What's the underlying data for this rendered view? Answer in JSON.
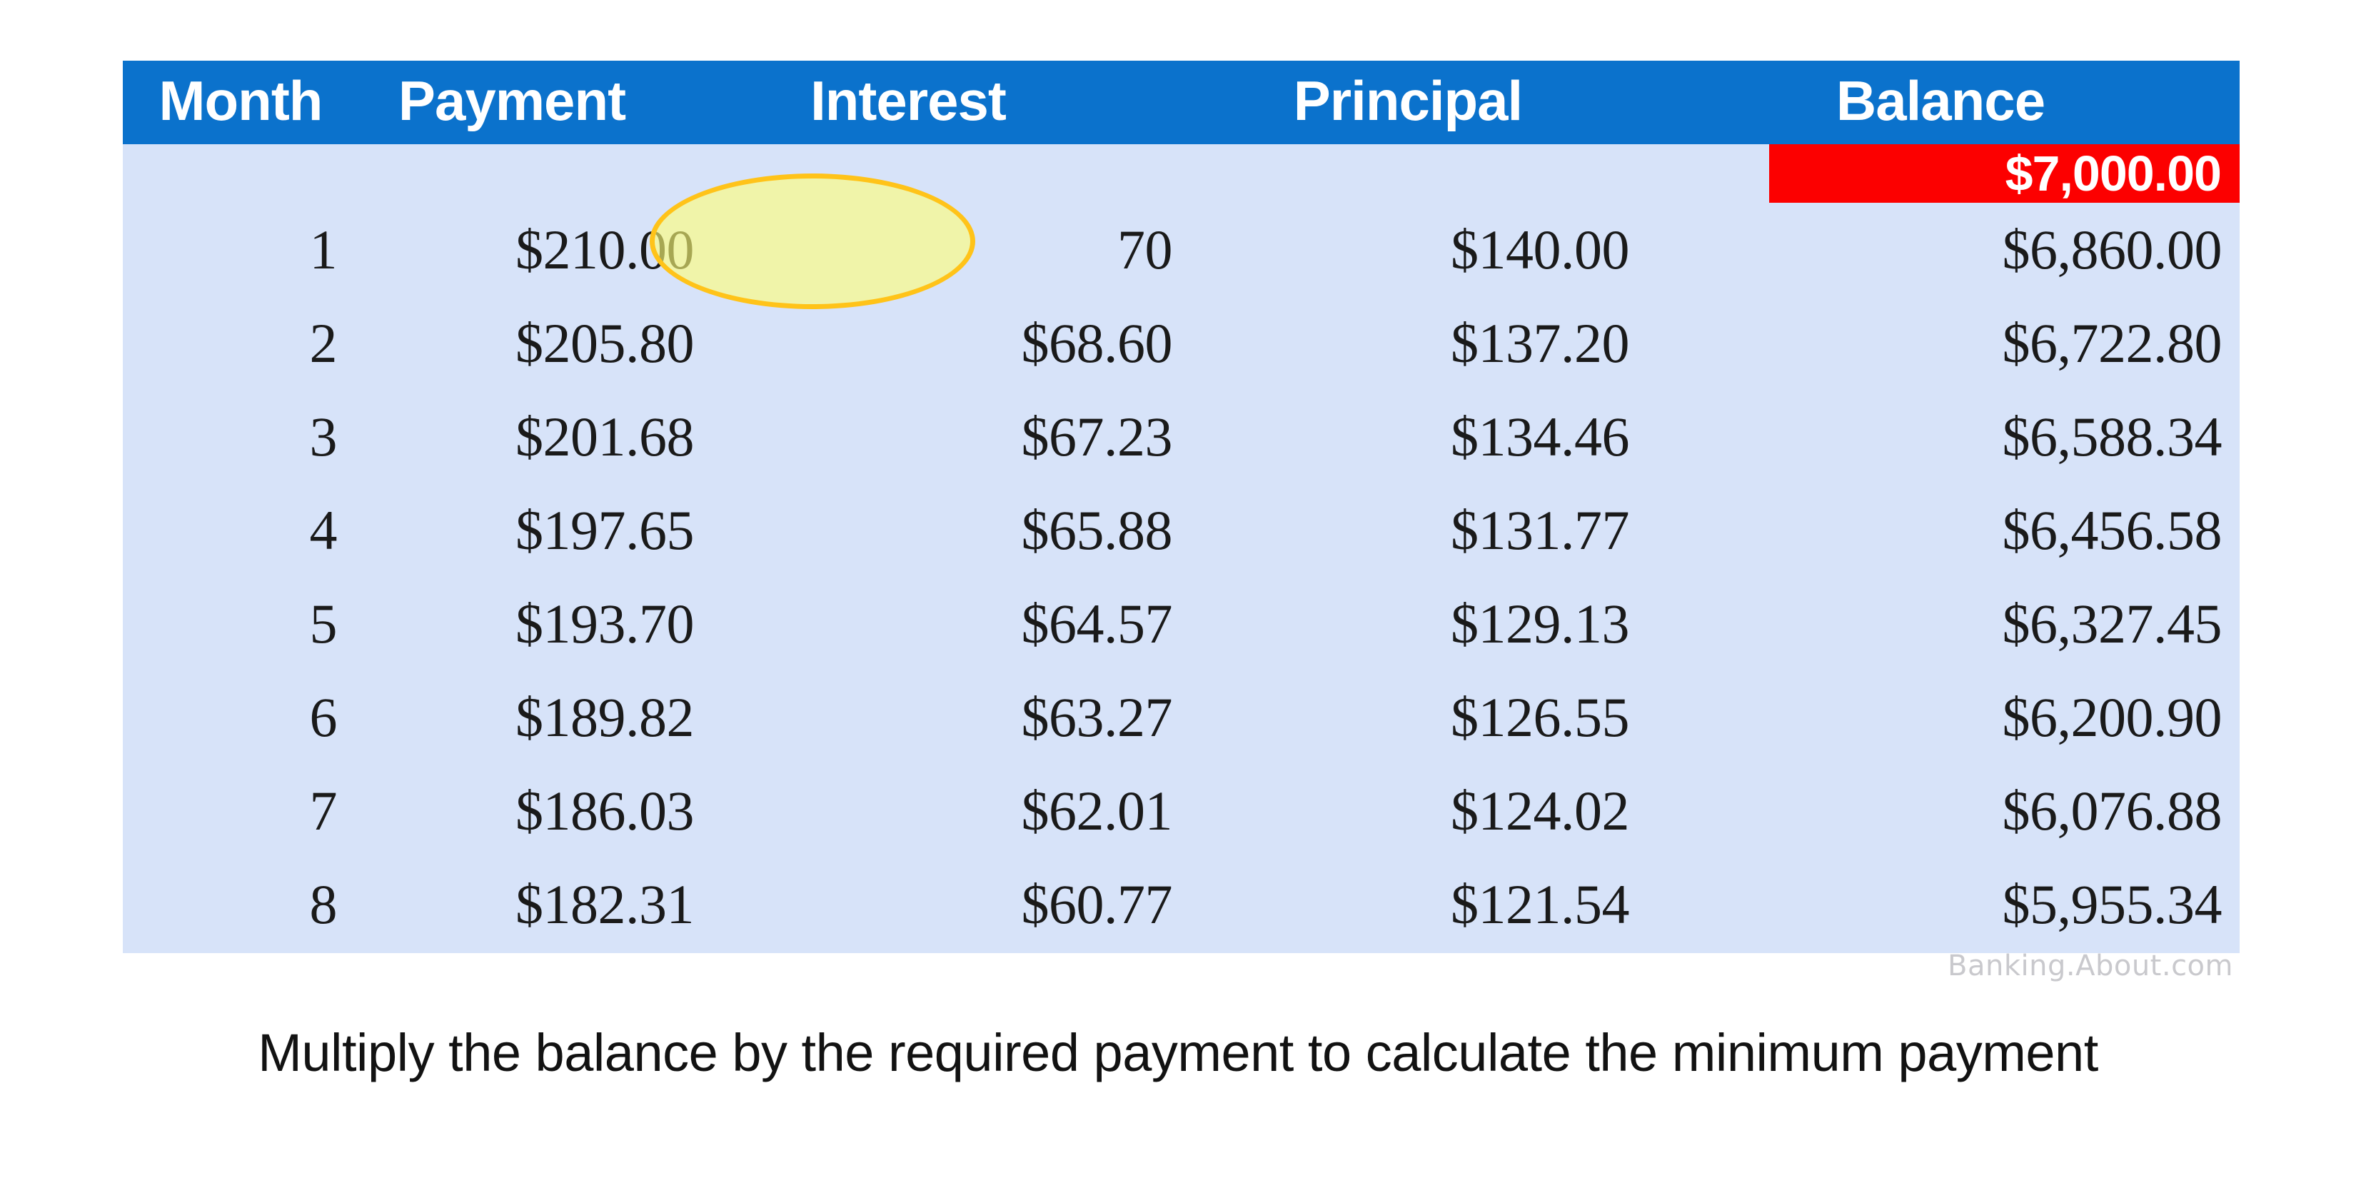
{
  "table": {
    "columns": [
      "Month",
      "Payment",
      "Interest",
      "Principal",
      "Balance"
    ],
    "opening_balance_label": "$7,000.00",
    "rows": [
      {
        "month": "1",
        "payment": "$210.00",
        "interest": "70",
        "principal": "$140.00",
        "balance": "$6,860.00"
      },
      {
        "month": "2",
        "payment": "$205.80",
        "interest": "$68.60",
        "principal": "$137.20",
        "balance": "$6,722.80"
      },
      {
        "month": "3",
        "payment": "$201.68",
        "interest": "$67.23",
        "principal": "$134.46",
        "balance": "$6,588.34"
      },
      {
        "month": "4",
        "payment": "$197.65",
        "interest": "$65.88",
        "principal": "$131.77",
        "balance": "$6,456.58"
      },
      {
        "month": "5",
        "payment": "$193.70",
        "interest": "$64.57",
        "principal": "$129.13",
        "balance": "$6,327.45"
      },
      {
        "month": "6",
        "payment": "$189.82",
        "interest": "$63.27",
        "principal": "$126.55",
        "balance": "$6,200.90"
      },
      {
        "month": "7",
        "payment": "$186.03",
        "interest": "$62.01",
        "principal": "$124.02",
        "balance": "$6,076.88"
      },
      {
        "month": "8",
        "payment": "$182.31",
        "interest": "$60.77",
        "principal": "$121.54",
        "balance": "$5,955.34"
      }
    ]
  },
  "watermark": "Banking.About.com",
  "caption": "Multiply the balance by the required payment to calculate the minimum payment",
  "colors": {
    "header_blue": "#0b72cc",
    "body_blue": "#d7e3f9",
    "opening_balance_red": "#fc0000",
    "highlight_fill": "#ffff78",
    "highlight_border": "#ffc319",
    "header_text": "#ffffff",
    "body_text": "#1a1a1a",
    "watermark_text": "#c9c9cd"
  }
}
